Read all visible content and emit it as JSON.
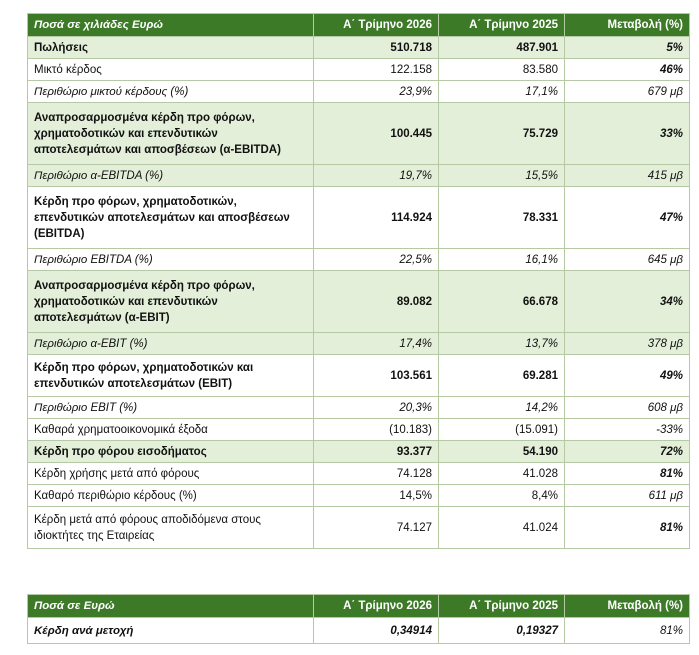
{
  "main_table": {
    "headers": [
      "Ποσά σε χιλιάδες Ευρώ",
      "Α΄ Τρίμηνο 2026",
      "Α΄ Τρίμηνο 2025",
      "Μεταβολή (%)"
    ],
    "rows": [
      {
        "label": "Πωλήσεις",
        "q2026": "510.718",
        "q2025": "487.901",
        "change": "5%",
        "style": "bold hl"
      },
      {
        "label": "Μικτό κέρδος",
        "q2026": "122.158",
        "q2025": "83.580",
        "change": "46%",
        "style": ""
      },
      {
        "label": "Περιθώριο μικτού κέρδους (%)",
        "q2026": "23,9%",
        "q2025": "17,1%",
        "change": "679 μβ",
        "style": "it"
      },
      {
        "label": "Αναπροσαρμοσμένα κέρδη προ φόρων, χρηματοδοτικών και επενδυτικών αποτελεσμάτων και αποσβέσεων (α-EBITDA)",
        "q2026": "100.445",
        "q2025": "75.729",
        "change": "33%",
        "style": "bold hl"
      },
      {
        "label": "Περιθώριο α-EBITDA (%)",
        "q2026": "19,7%",
        "q2025": "15,5%",
        "change": "415 μβ",
        "style": "it hl"
      },
      {
        "label": "Κέρδη προ φόρων, χρηματοδοτικών, επενδυτικών αποτελεσμάτων και αποσβέσεων (EBITDA)",
        "q2026": "114.924",
        "q2025": "78.331",
        "change": "47%",
        "style": "bold"
      },
      {
        "label": "Περιθώριο EBITDA (%)",
        "q2026": "22,5%",
        "q2025": "16,1%",
        "change": "645 μβ",
        "style": "it"
      },
      {
        "label": "Αναπροσαρμοσμένα κέρδη προ φόρων, χρηματοδοτικών και επενδυτικών αποτελεσμάτων (α-EBIT)",
        "q2026": "89.082",
        "q2025": "66.678",
        "change": "34%",
        "style": "bold hl"
      },
      {
        "label": "Περιθώριο α-EBIT (%)",
        "q2026": "17,4%",
        "q2025": "13,7%",
        "change": "378 μβ",
        "style": "it hl"
      },
      {
        "label": "Κέρδη προ φόρων, χρηματοδοτικών και επενδυτικών αποτελεσμάτων (EBIT)",
        "q2026": "103.561",
        "q2025": "69.281",
        "change": "49%",
        "style": "bold"
      },
      {
        "label": "Περιθώριο EBIT (%)",
        "q2026": "20,3%",
        "q2025": "14,2%",
        "change": "608 μβ",
        "style": "it"
      },
      {
        "label": "Καθαρά χρηματοοικονομικά έξοδα",
        "q2026": "(10.183)",
        "q2025": "(15.091)",
        "change": "-33%",
        "style": "plain-change"
      },
      {
        "label": "Κέρδη προ φόρου εισοδήματος",
        "q2026": "93.377",
        "q2025": "54.190",
        "change": "72%",
        "style": "bold hl"
      },
      {
        "label": "Κέρδη χρήσης μετά από φόρους",
        "q2026": "74.128",
        "q2025": "41.028",
        "change": "81%",
        "style": ""
      },
      {
        "label": "Καθαρό περιθώριο κέρδους (%)",
        "q2026": "14,5%",
        "q2025": "8,4%",
        "change": "611 μβ",
        "style": "plain-change"
      },
      {
        "label": "Κέρδη μετά από φόρους αποδιδόμενα στους ιδιοκτήτες της Εταιρείας",
        "q2026": "74.127",
        "q2025": "41.024",
        "change": "81%",
        "style": ""
      }
    ]
  },
  "eps_table": {
    "headers": [
      "Ποσά σε Ευρώ",
      "Α΄ Τρίμηνο 2026",
      "Α΄ Τρίμηνο 2025",
      "Μεταβολή (%)"
    ],
    "rows": [
      {
        "label": "Κέρδη ανά μετοχή",
        "q2026": "0,34914",
        "q2025": "0,19327",
        "change": "81%",
        "style": "bold it eps"
      }
    ]
  }
}
